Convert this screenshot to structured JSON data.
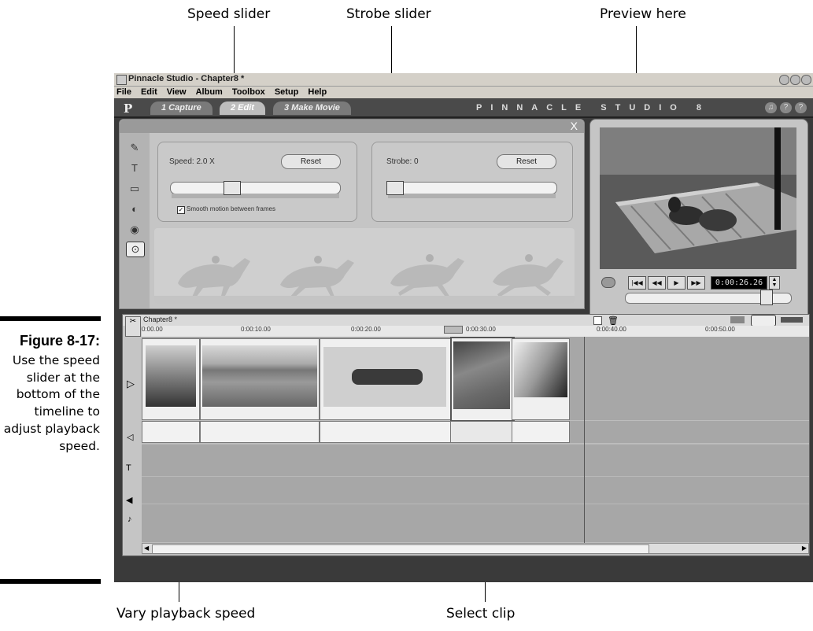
{
  "callouts": {
    "speed_slider": "Speed slider",
    "strobe_slider": "Strobe slider",
    "preview_here": "Preview here",
    "vary_speed": "Vary playback speed",
    "select_clip": "Select clip"
  },
  "figure": {
    "number": "Figure 8-17:",
    "caption": "Use the speed slider at the bottom of the timeline to adjust playback speed."
  },
  "window": {
    "title": "Pinnacle Studio - Chapter8 *",
    "menus": [
      "File",
      "Edit",
      "View",
      "Album",
      "Toolbox",
      "Setup",
      "Help"
    ],
    "logo": "P",
    "tabs": [
      "1 Capture",
      "2 Edit",
      "3 Make Movie"
    ],
    "brand": "PINNACLE STUDIO 8",
    "help_buttons": [
      "♫",
      "?",
      "?"
    ]
  },
  "toolbox": {
    "close": "X",
    "speed_label": "Speed: 2.0 X",
    "speed_reset": "Reset",
    "speed_value": 0.35,
    "smooth_label": "Smooth motion between frames",
    "smooth_checked": true,
    "strobe_label": "Strobe: 0",
    "strobe_reset": "Reset",
    "strobe_value": 0
  },
  "preview": {
    "timecode": "0:00:26.26",
    "buttons": [
      "|◀◀",
      "◀◀",
      "▶",
      "▶▶"
    ],
    "scrub_value": 0.88
  },
  "timeline": {
    "project": "Chapter8 *",
    "ticks": [
      "0:00.00",
      "0:00:10.00",
      "0:00:20.00",
      "0:00:30.00",
      "0:00:40.00",
      "0:00:50.00"
    ]
  }
}
